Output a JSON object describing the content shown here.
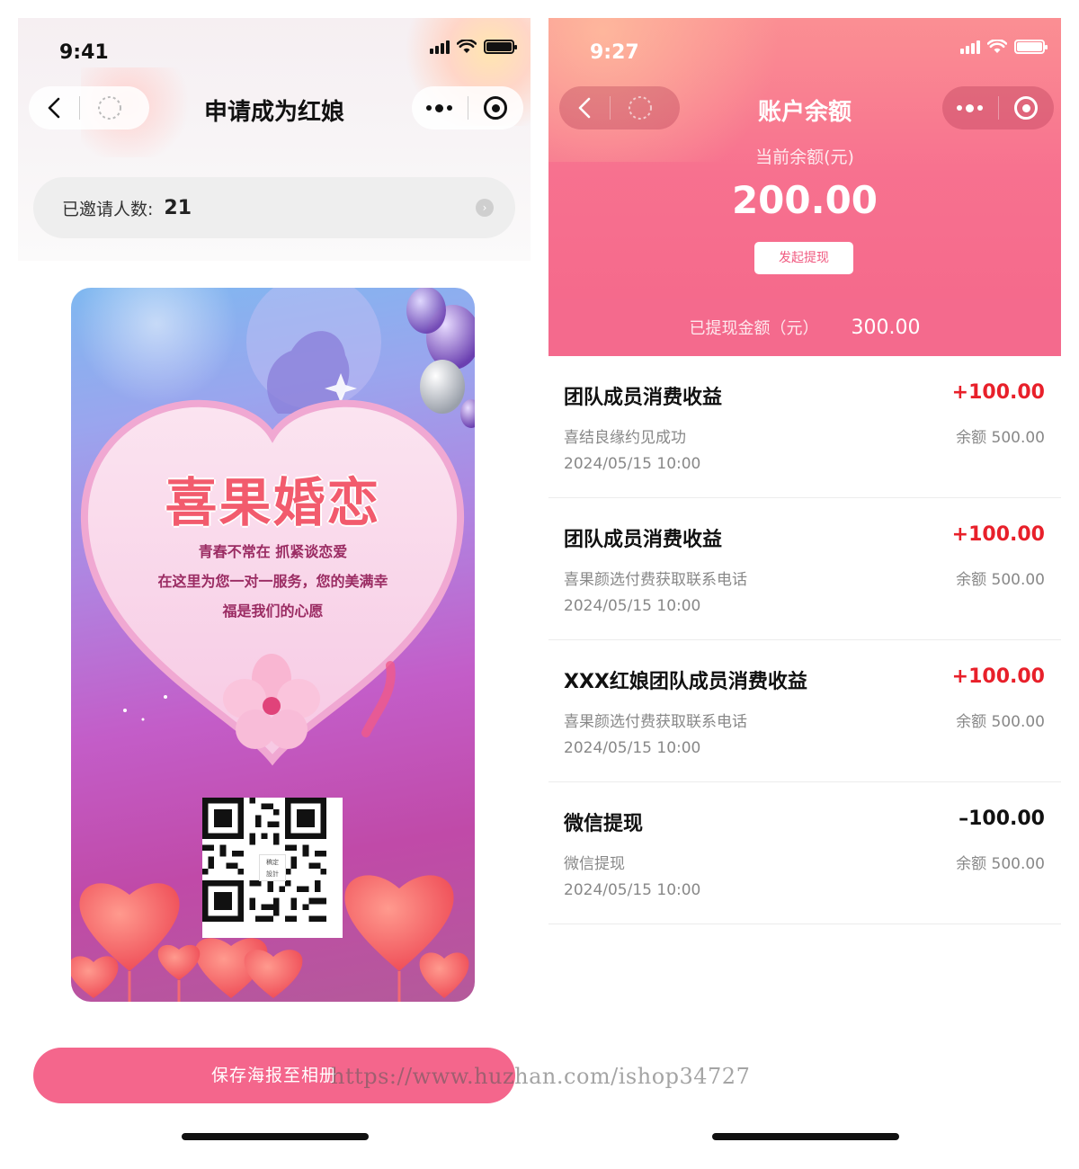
{
  "left": {
    "status_time": "9:41",
    "title": "申请成为红娘",
    "invite": {
      "label": "已邀请人数:",
      "count": "21"
    },
    "poster": {
      "brand": "喜果婚恋",
      "lines": [
        "青春不常在 抓紧谈恋爱",
        "在这里为您一对一服务，您的美满幸",
        "福是我们的心愿"
      ],
      "qr_center_text": [
        "稿定",
        "設計"
      ]
    },
    "save_button": "保存海报至相册"
  },
  "right": {
    "status_time": "9:27",
    "title": "账户余额",
    "balance_label": "当前余额(元)",
    "balance_value": "200.00",
    "withdraw_button": "发起提现",
    "withdrawn_label": "已提现金额（元）",
    "withdrawn_value": "300.00",
    "transactions": [
      {
        "title": "团队成员消费收益",
        "amount": "+100.00",
        "desc": "喜结良缘约见成功",
        "balance": "余额 500.00",
        "time": "2024/05/15  10:00",
        "color": "#e8202a"
      },
      {
        "title": "团队成员消费收益",
        "amount": "+100.00",
        "desc": "喜果颜选付费获取联系电话",
        "balance": "余额 500.00",
        "time": "2024/05/15  10:00",
        "color": "#e8202a"
      },
      {
        "title": "XXX红娘团队成员消费收益",
        "amount": "+100.00",
        "desc": "喜果颜选付费获取联系电话",
        "balance": "余额 500.00",
        "time": "2024/05/15  10:00",
        "color": "#e8202a"
      },
      {
        "title": "微信提现",
        "amount": "–100.00",
        "desc": "微信提现",
        "balance": "余额 500.00",
        "time": "2024/05/15  10:00",
        "color": "#111111"
      }
    ]
  },
  "watermark": "https://www.huzhan.com/ishop34727",
  "colors": {
    "accent_pink": "#f4668c",
    "income_red": "#e8202a"
  },
  "icons": [
    "back-icon",
    "home-circle-icon",
    "more-dots-icon",
    "target-icon",
    "chevron-right-icon",
    "signal-icon",
    "wifi-icon",
    "battery-icon"
  ]
}
